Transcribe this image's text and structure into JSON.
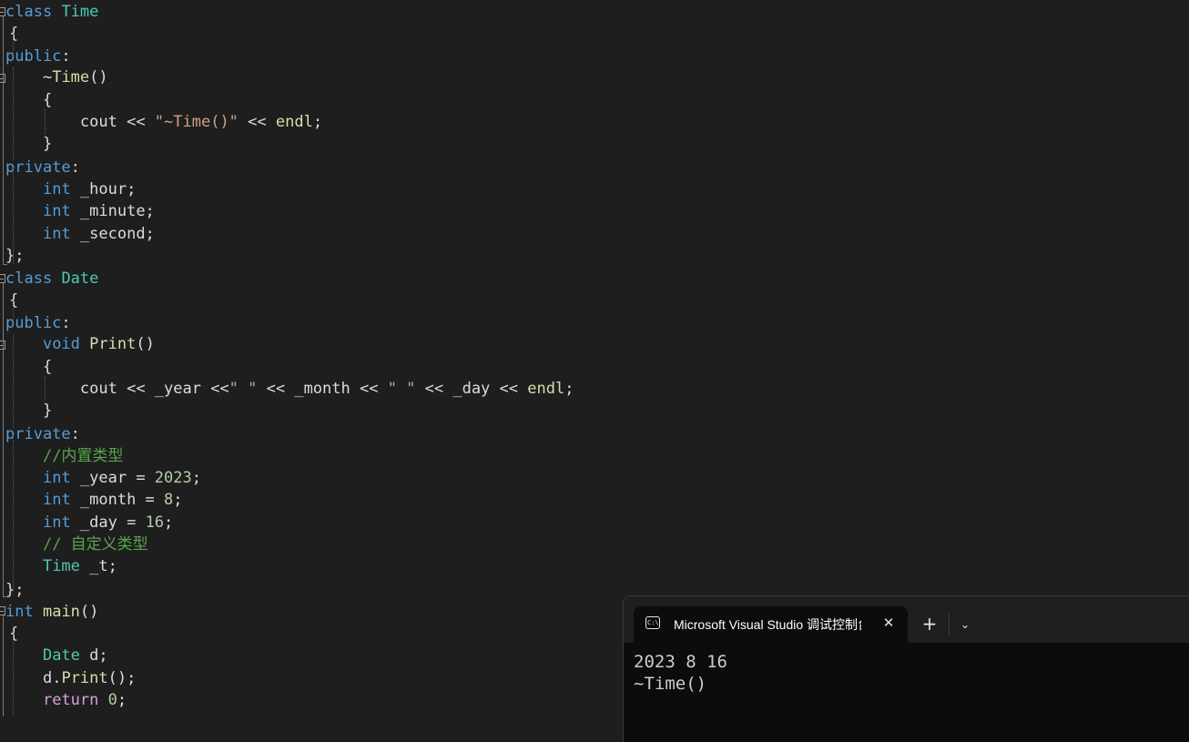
{
  "colors": {
    "background": "#1e1e1e",
    "text": "#dcdcdc",
    "keyword": "#569cd6",
    "type": "#4ec9b0",
    "function": "#dcdcaa",
    "string": "#d69d85",
    "number": "#b5cea8",
    "comment": "#57a64a",
    "control": "#d8a0df",
    "variable": "#9cdcfe"
  },
  "editor": {
    "lines": [
      [
        [
          "class",
          "keyword"
        ],
        [
          " ",
          "text"
        ],
        [
          "Time",
          "type"
        ]
      ],
      [
        [
          "{",
          "text"
        ]
      ],
      [
        [
          "public",
          "keyword"
        ],
        [
          ":",
          "text"
        ]
      ],
      [
        [
          "    ",
          "text"
        ],
        [
          "~",
          "text"
        ],
        [
          "Time",
          "function"
        ],
        [
          "()",
          "text"
        ]
      ],
      [
        [
          "    ",
          "text"
        ],
        [
          "{",
          "text"
        ]
      ],
      [
        [
          "        ",
          "text"
        ],
        [
          "cout",
          "text"
        ],
        [
          " << ",
          "text"
        ],
        [
          "\"~Time()\"",
          "string"
        ],
        [
          " << ",
          "text"
        ],
        [
          "endl",
          "function"
        ],
        [
          ";",
          "text"
        ]
      ],
      [
        [
          "    ",
          "text"
        ],
        [
          "}",
          "text"
        ]
      ],
      [
        [
          "private",
          "keyword"
        ],
        [
          ":",
          "text"
        ]
      ],
      [
        [
          "    ",
          "text"
        ],
        [
          "int",
          "keyword"
        ],
        [
          " _hour;",
          "text"
        ]
      ],
      [
        [
          "    ",
          "text"
        ],
        [
          "int",
          "keyword"
        ],
        [
          " _minute;",
          "text"
        ]
      ],
      [
        [
          "    ",
          "text"
        ],
        [
          "int",
          "keyword"
        ],
        [
          " _second;",
          "text"
        ]
      ],
      [
        [
          "};",
          "text"
        ]
      ],
      [
        [
          "class",
          "keyword"
        ],
        [
          " ",
          "text"
        ],
        [
          "Date",
          "type"
        ]
      ],
      [
        [
          "{",
          "text"
        ]
      ],
      [
        [
          "public",
          "keyword"
        ],
        [
          ":",
          "text"
        ]
      ],
      [
        [
          "    ",
          "text"
        ],
        [
          "void",
          "keyword"
        ],
        [
          " ",
          "text"
        ],
        [
          "Print",
          "function"
        ],
        [
          "()",
          "text"
        ]
      ],
      [
        [
          "    ",
          "text"
        ],
        [
          "{",
          "text"
        ]
      ],
      [
        [
          "        ",
          "text"
        ],
        [
          "cout",
          "text"
        ],
        [
          " << _year <<",
          "text"
        ],
        [
          "\" \"",
          "string"
        ],
        [
          " << _month << ",
          "text"
        ],
        [
          "\" \"",
          "string"
        ],
        [
          " << _day << ",
          "text"
        ],
        [
          "endl",
          "function"
        ],
        [
          ";",
          "text"
        ]
      ],
      [
        [
          "    ",
          "text"
        ],
        [
          "}",
          "text"
        ]
      ],
      [
        [
          "private",
          "keyword"
        ],
        [
          ":",
          "text"
        ]
      ],
      [
        [
          "    ",
          "text"
        ],
        [
          "//内置类型",
          "comment"
        ]
      ],
      [
        [
          "    ",
          "text"
        ],
        [
          "int",
          "keyword"
        ],
        [
          " _year = ",
          "text"
        ],
        [
          "2023",
          "number"
        ],
        [
          ";",
          "text"
        ]
      ],
      [
        [
          "    ",
          "text"
        ],
        [
          "int",
          "keyword"
        ],
        [
          " _month = ",
          "text"
        ],
        [
          "8",
          "number"
        ],
        [
          ";",
          "text"
        ]
      ],
      [
        [
          "    ",
          "text"
        ],
        [
          "int",
          "keyword"
        ],
        [
          " _day = ",
          "text"
        ],
        [
          "16",
          "number"
        ],
        [
          ";",
          "text"
        ]
      ],
      [
        [
          "    ",
          "text"
        ],
        [
          "// 自定义类型",
          "comment"
        ]
      ],
      [
        [
          "    ",
          "text"
        ],
        [
          "Time",
          "type"
        ],
        [
          " _t;",
          "text"
        ]
      ],
      [
        [
          "};",
          "text"
        ]
      ],
      [
        [
          "int",
          "keyword"
        ],
        [
          " ",
          "text"
        ],
        [
          "main",
          "function"
        ],
        [
          "()",
          "text"
        ]
      ],
      [
        [
          "{",
          "text"
        ]
      ],
      [
        [
          "    ",
          "text"
        ],
        [
          "Date",
          "type"
        ],
        [
          " d;",
          "text"
        ]
      ],
      [
        [
          "    ",
          "text"
        ],
        [
          "d",
          "text"
        ],
        [
          ".",
          "text"
        ],
        [
          "Print",
          "function"
        ],
        [
          "();",
          "text"
        ]
      ],
      [
        [
          "    ",
          "text"
        ],
        [
          "return",
          "control"
        ],
        [
          " ",
          "text"
        ],
        [
          "0",
          "number"
        ],
        [
          ";",
          "text"
        ]
      ]
    ]
  },
  "terminal": {
    "tab_icon": "terminal-icon",
    "tab_icon_text": "C:\\",
    "tab_title": "Microsoft Visual Studio 调试控制台",
    "close_icon": "close-icon",
    "close_glyph": "✕",
    "new_tab_glyph": "+",
    "dropdown_glyph": "⌄",
    "output": [
      "2023 8 16",
      "~Time()"
    ]
  }
}
